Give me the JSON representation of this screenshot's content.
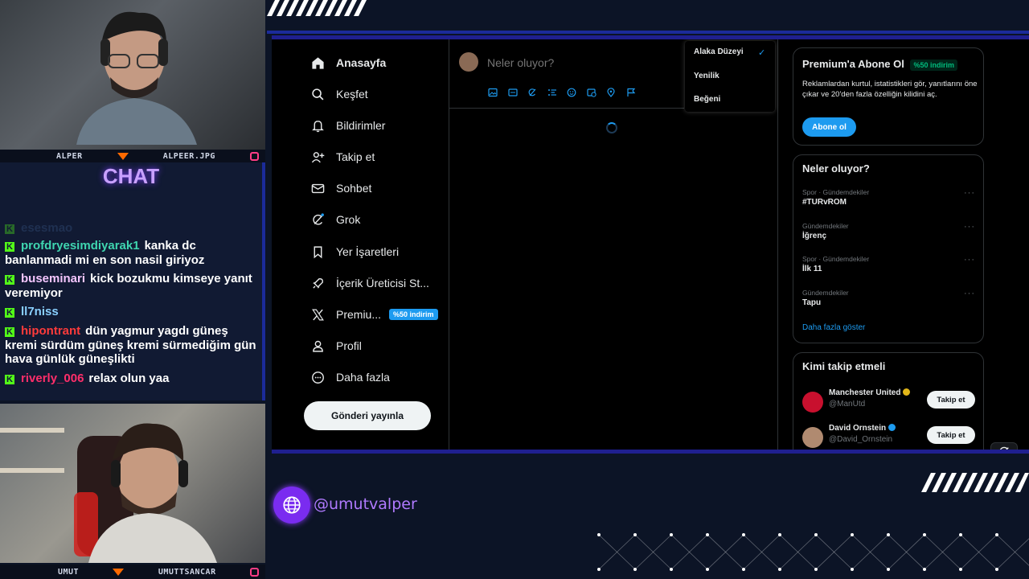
{
  "overlay": {
    "cam_top": {
      "left_name": "ALPER",
      "right_name": "ALPEER.JPG"
    },
    "chat_title": "CHAT",
    "chat_messages": [
      {
        "user": "esesmao",
        "text": "",
        "user_color": "#3a5a8a"
      },
      {
        "user": "profdryesimdiyarak1",
        "text": "kanka dc banlanmadi mi en son nasil giriyoz",
        "user_color": "#3fd6b0"
      },
      {
        "user": "buseminari",
        "text": "kick bozukmu kimseye yanıt veremiyor",
        "user_color": "#f5c6ff"
      },
      {
        "user": "ll7niss",
        "text": "",
        "user_color": "#8ad0ff"
      },
      {
        "user": "hipontrant",
        "text": "dün yagmur yagdı güneş kremi sürdüm güneş kremi sürmediğim gün hava günlük güneşlikti",
        "user_color": "#ff3b3b"
      },
      {
        "user": "riverly_006",
        "text": "relax olun yaa",
        "user_color": "#ff2e6a"
      }
    ],
    "cam_bottom": {
      "left_name": "UMUT",
      "right_name": "UMUTTSANCAR"
    },
    "social_handle": "@umutvalper"
  },
  "x_app": {
    "nav": [
      {
        "label": "Anasayfa",
        "icon": "home-icon",
        "active": true
      },
      {
        "label": "Keşfet",
        "icon": "search-icon"
      },
      {
        "label": "Bildirimler",
        "icon": "bell-icon"
      },
      {
        "label": "Takip et",
        "icon": "add-user-icon"
      },
      {
        "label": "Sohbet",
        "icon": "envelope-icon"
      },
      {
        "label": "Grok",
        "icon": "grok-icon"
      },
      {
        "label": "Yer İşaretleri",
        "icon": "bookmark-icon"
      },
      {
        "label": "İçerik Üreticisi St...",
        "icon": "rocket-icon"
      },
      {
        "label": "Premiu...",
        "icon": "x-logo-icon",
        "badge": "%50 indirim"
      },
      {
        "label": "Profil",
        "icon": "person-icon"
      },
      {
        "label": "Daha fazla",
        "icon": "more-circle-icon"
      }
    ],
    "post_button": "Gönderi yayınla",
    "composer": {
      "placeholder": "Neler oluyor?"
    },
    "sort_menu": {
      "options": [
        "Alaka Düzeyi",
        "Yenilik",
        "Beğeni"
      ],
      "selected": "Alaka Düzeyi"
    },
    "premium_card": {
      "title": "Premium'a Abone Ol",
      "badge": "%50 indirim",
      "body": "Reklamlardan kurtul, istatistikleri gör, yanıtlarını öne çıkar ve 20'den fazla özelliğin kilidini aç.",
      "button": "Abone ol"
    },
    "trends_card": {
      "title": "Neler oluyor?",
      "items": [
        {
          "category": "Spor · Gündemdekiler",
          "name": "#TURvROM"
        },
        {
          "category": "Gündemdekiler",
          "name": "İğrenç"
        },
        {
          "category": "Spor · Gündemdekiler",
          "name": "İlk 11"
        },
        {
          "category": "Gündemdekiler",
          "name": "Tapu"
        }
      ],
      "show_more": "Daha fazla göster"
    },
    "follow_card": {
      "title": "Kimi takip etmeli",
      "accounts": [
        {
          "name": "Manchester United",
          "handle": "@ManUtd",
          "verified_color": "#e2b719",
          "avatar_color": "#c8102e"
        },
        {
          "name": "David Ornstein",
          "handle": "@David_Ornstein",
          "verified_color": "#1d9bf0",
          "avatar_color": "#b08a70"
        }
      ],
      "follow_label": "Takip et"
    },
    "accent_color": "#1d9bf0"
  }
}
